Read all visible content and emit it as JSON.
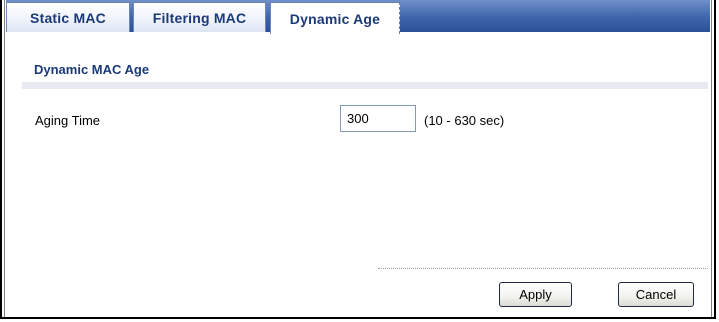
{
  "tabs": [
    {
      "label": "Static MAC",
      "active": false
    },
    {
      "label": "Filtering MAC",
      "active": false
    },
    {
      "label": "Dynamic Age",
      "active": true
    }
  ],
  "section": {
    "title": "Dynamic MAC Age"
  },
  "aging": {
    "label": "Aging Time",
    "value": "300",
    "range": "(10 - 630 sec)"
  },
  "actions": {
    "apply_label": "Apply",
    "cancel_label": "Cancel"
  },
  "colors": {
    "tabbar_blue": "#3f64ad",
    "tab_text": "#1b3a78",
    "section_title": "#1b3a78",
    "rule_gray": "#e6e9ef"
  }
}
